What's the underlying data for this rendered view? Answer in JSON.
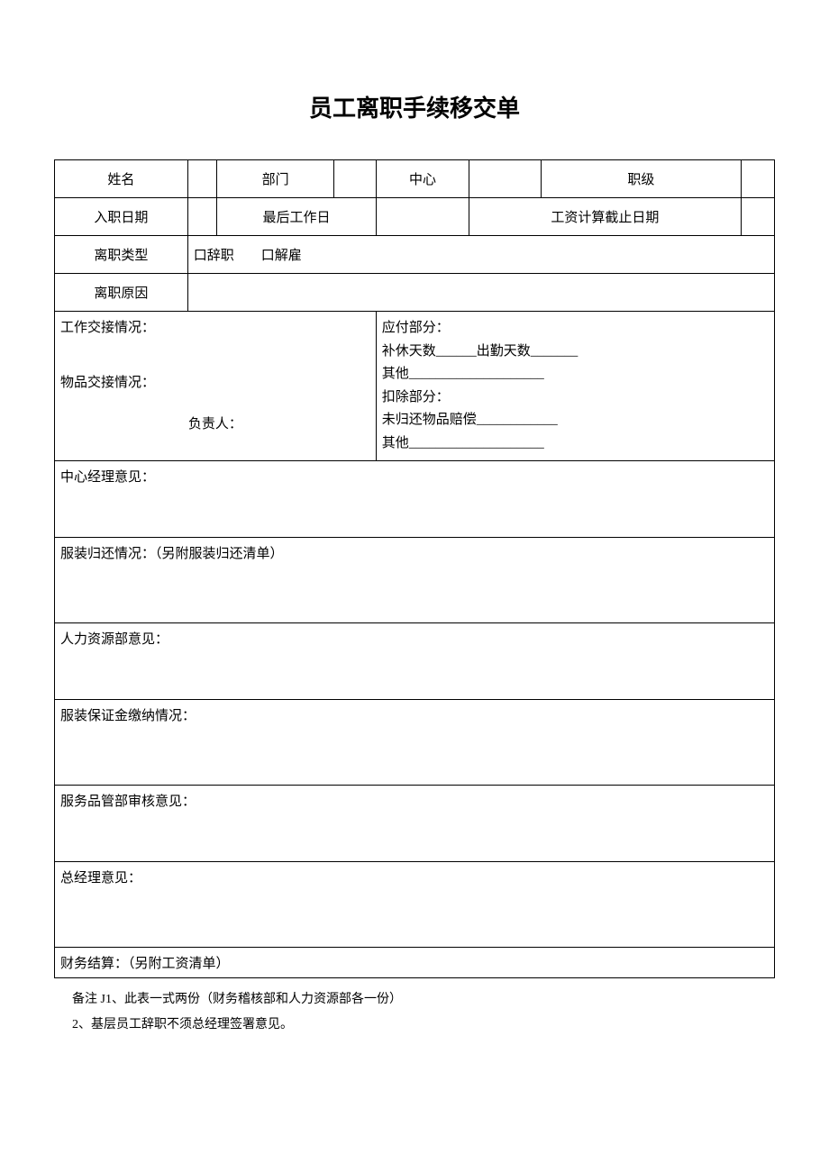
{
  "title": "员工离职手续移交单",
  "row1": {
    "nameLabel": "姓名",
    "nameValue": "",
    "deptLabel": "部门",
    "deptValue": "",
    "centerLabel": "中心",
    "centerValue": "",
    "rankLabel": "职级",
    "rankValue": ""
  },
  "row2": {
    "entryDateLabel": "入职日期",
    "entryDateValue": "",
    "lastDayLabel": "最后工作日",
    "lastDayValue": "",
    "salaryCutoffLabel": "工资计算截止日期",
    "salaryCutoffValue": ""
  },
  "row3": {
    "typeLabel": "离职类型",
    "option1": "口辞职",
    "option2": "口解雇"
  },
  "row4": {
    "reasonLabel": "离职原因",
    "reasonValue": ""
  },
  "handover": {
    "workHandover": "工作交接情况：",
    "itemHandover": "物品交接情况：",
    "responsible": "负责人：",
    "payable": "应付部分：",
    "compDays": "补休天数______出勤天数_______",
    "other1": "其他____________________",
    "deduct": "扣除部分：",
    "unreturned": "未归还物品赔偿____________",
    "other2": "其他____________________"
  },
  "sections": {
    "centerManager": "中心经理意见：",
    "clothingReturn": "服装归还情况：（另附服装归还清单）",
    "hr": "人力资源部意见：",
    "clothingDeposit": "服装保证金缴纳情况：",
    "serviceQC": "服务品管部审核意见：",
    "gm": "总经理意见：",
    "finance": "财务结算：（另附工资清单）"
  },
  "notes": {
    "note1": "备注 J1、此表一式两份（财务稽核部和人力资源部各一份）",
    "note2": "2、基层员工辞职不须总经理签署意见。"
  }
}
